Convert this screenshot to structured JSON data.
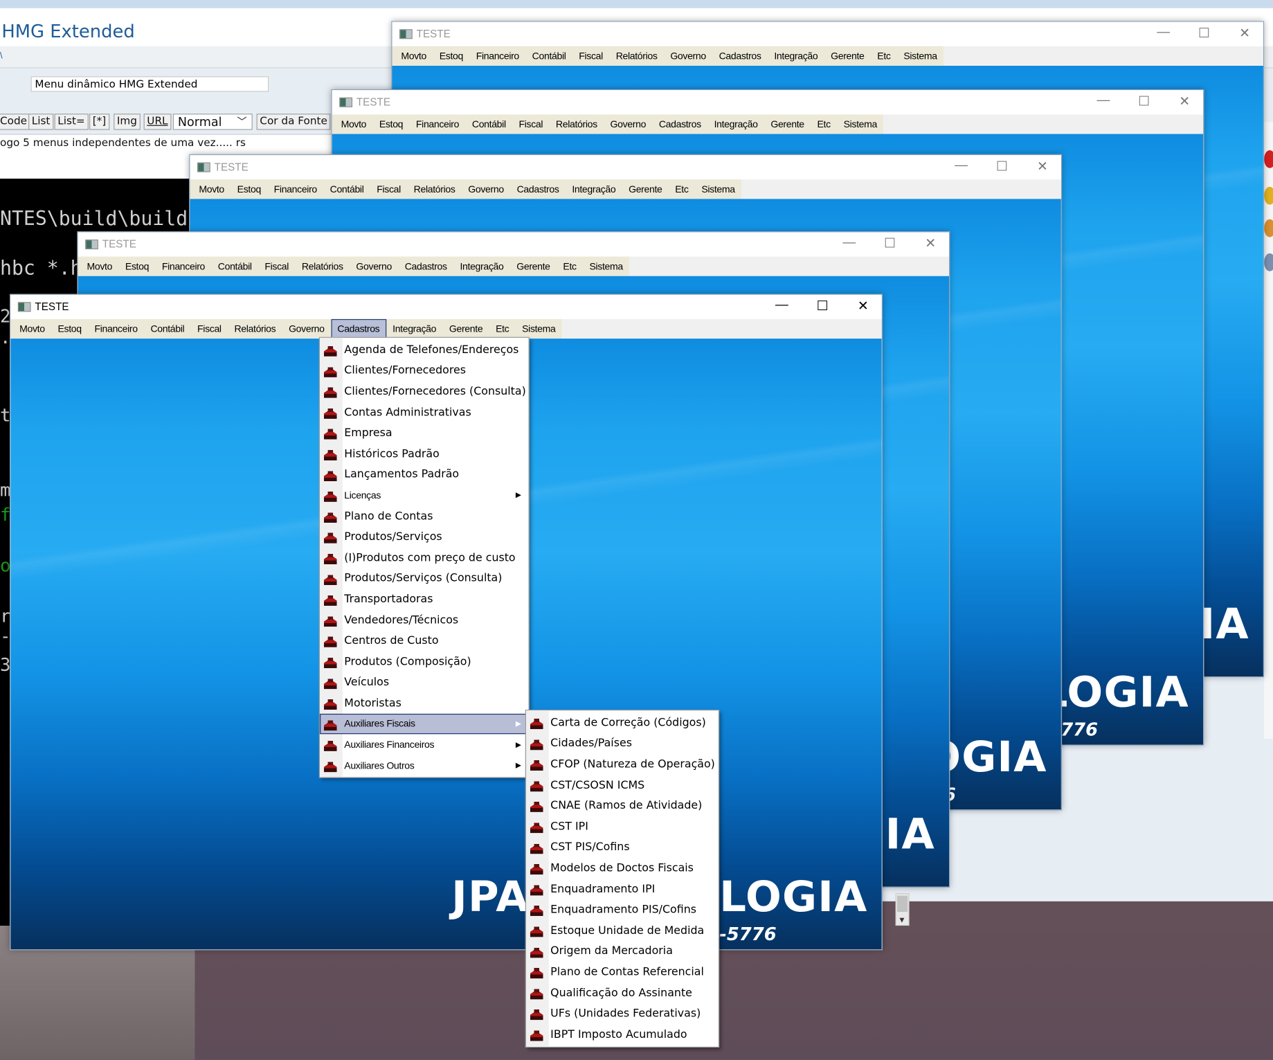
{
  "browser_page": {
    "site_title": "HMG Extended",
    "forum_bar_char": "\\",
    "subject_value": "Menu dinâmico HMG Extended",
    "toolbar": [
      "Code",
      "List",
      "List=",
      "[*]",
      "Img",
      "URL"
    ],
    "font_size_select": "Normal",
    "font_color_button": "Cor da Fonte",
    "message_text": "ogo 5 menus independentes de uma vez..... rs"
  },
  "console": {
    "lines": [
      {
        "text": "NTES\\build\\build.e",
        "color": "#d0d0d0"
      },
      {
        "text": "hbc *.h",
        "color": "#d0d0d0"
      },
      {
        "text": "2",
        "color": "#d0d0d0"
      },
      {
        "text": "·",
        "color": "#d0d0d0"
      },
      {
        "text": "t",
        "color": "#d0d0d0"
      },
      {
        "text": "m",
        "color": "#d0d0d0"
      },
      {
        "text": "f",
        "color": "#1a9a1a"
      },
      {
        "text": "o",
        "color": "#1a9a1a"
      },
      {
        "text": "r",
        "color": "#d0d0d0"
      },
      {
        "text": "-",
        "color": "#d0d0d0"
      },
      {
        "text": "3",
        "color": "#d0d0d0"
      }
    ]
  },
  "window": {
    "title": "TESTE",
    "controls": {
      "minimize": "—",
      "maximize": "☐",
      "close": "✕"
    },
    "menu_bar": [
      "Movto",
      "Estoq",
      "Financeiro",
      "Contábil",
      "Fiscal",
      "Relatórios",
      "Governo",
      "Cadastros",
      "Integração",
      "Gerente",
      "Etc",
      "Sistema"
    ],
    "open_menu": "Cadastros",
    "logo_left": "JPA",
    "logo_right": "LOGIA",
    "phone": "-5776"
  },
  "window_count": 5,
  "cadastros_menu": [
    {
      "label": "Agenda de Telefones/Endereços",
      "has_submenu": false
    },
    {
      "label": "Clientes/Fornecedores",
      "has_submenu": false
    },
    {
      "label": "Clientes/Fornecedores (Consulta)",
      "has_submenu": false
    },
    {
      "label": "Contas Administrativas",
      "has_submenu": false
    },
    {
      "label": "Empresa",
      "has_submenu": false
    },
    {
      "label": "Históricos Padrão",
      "has_submenu": false
    },
    {
      "label": "Lançamentos Padrão",
      "has_submenu": false
    },
    {
      "label": "Licenças",
      "has_submenu": true
    },
    {
      "label": "Plano de Contas",
      "has_submenu": false
    },
    {
      "label": "Produtos/Serviços",
      "has_submenu": false
    },
    {
      "label": "(I)Produtos com preço de custo",
      "has_submenu": false
    },
    {
      "label": "Produtos/Serviços (Consulta)",
      "has_submenu": false
    },
    {
      "label": "Transportadoras",
      "has_submenu": false
    },
    {
      "label": "Vendedores/Técnicos",
      "has_submenu": false
    },
    {
      "label": "Centros de Custo",
      "has_submenu": false
    },
    {
      "label": "Produtos (Composição)",
      "has_submenu": false
    },
    {
      "label": "Veículos",
      "has_submenu": false
    },
    {
      "label": "Motoristas",
      "has_submenu": false
    },
    {
      "label": "Auxiliares Fiscais",
      "has_submenu": true,
      "highlighted": true
    },
    {
      "label": "Auxiliares Financeiros",
      "has_submenu": true
    },
    {
      "label": "Auxiliares Outros",
      "has_submenu": true
    }
  ],
  "auxiliares_fiscais_menu": [
    "Carta de Correção (Códigos)",
    "Cidades/Países",
    "CFOP (Natureza de Operação)",
    "CST/CSOSN ICMS",
    "CNAE (Ramos de Atividade)",
    "CST IPI",
    "CST PIS/Cofins",
    "Modelos de Doctos Fiscais",
    "Enquadramento IPI",
    "Enquadramento PIS/Cofins",
    "Estoque Unidade de Medida",
    "Origem da Mercadoria",
    "Plano de Contas Referencial",
    "Qualificação do Assinante",
    "UFs (Unidades Federativas)",
    "IBPT Imposto Acumulado"
  ],
  "colors": {
    "menu_highlight": "#b8bed6",
    "client_blue": "#1ea3ee",
    "site_title": "#1f5c99"
  }
}
